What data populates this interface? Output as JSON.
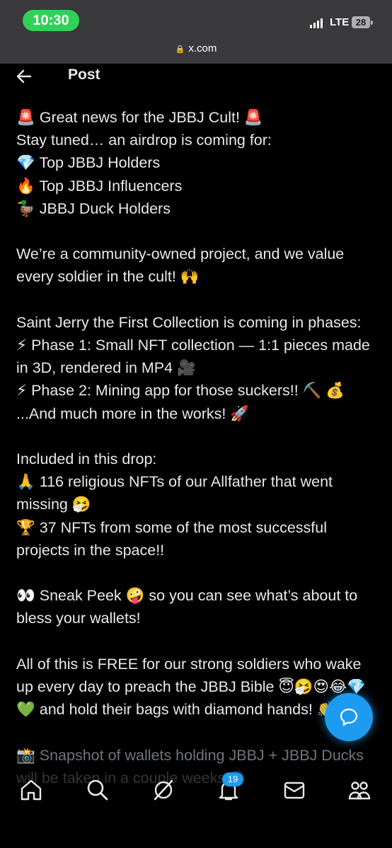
{
  "status_bar": {
    "time": "10:30",
    "network": "LTE",
    "battery": "28"
  },
  "browser": {
    "url": "x.com"
  },
  "header": {
    "title": "Post"
  },
  "post": {
    "lines": [
      "🚨 Great news for the JBBJ Cult! 🚨",
      "Stay tuned… an airdrop is coming for:",
      "💎 Top JBBJ Holders",
      "🔥 Top JBBJ Influencers",
      "🦆 JBBJ Duck Holders",
      "",
      "We’re a community-owned project, and we value every soldier in the cult! 🙌",
      "",
      "Saint Jerry the First Collection is coming in phases:",
      "⚡ Phase 1: Small NFT collection — 1:1 pieces made in 3D, rendered in MP4 🎥",
      "⚡ Phase 2: Mining app for those suckers!! ⛏️ 💰",
      "...And much more in the works! 🚀",
      "",
      "Included in this drop:",
      "🙏 116 religious NFTs of our Allfather that went missing 🤧",
      "🏆 37 NFTs from some of the most successful projects in the space!!",
      "",
      "👀 Sneak Peek 🤪 so you can see what’s about to bless your wallets!",
      "",
      "All of this is FREE for our strong soldiers who wake up every day to preach the JBBJ Bible 😇🤧😍😂💎💚 and hold their bags with diamond hands! 👏"
    ],
    "faded_lines": [
      "📸 Snapshot of wallets holding JBBJ + JBBJ Ducks will be taken in a couple weeks 😎"
    ]
  },
  "bottom_nav": {
    "items": [
      "home-icon",
      "search-icon",
      "grok-icon",
      "notifications-icon",
      "messages-icon",
      "communities-icon"
    ],
    "notification_count": "19"
  },
  "colors": {
    "accent": "#1d9bf0",
    "time_pill": "#30d158",
    "text": "#e7e9ea",
    "background": "#000000"
  }
}
